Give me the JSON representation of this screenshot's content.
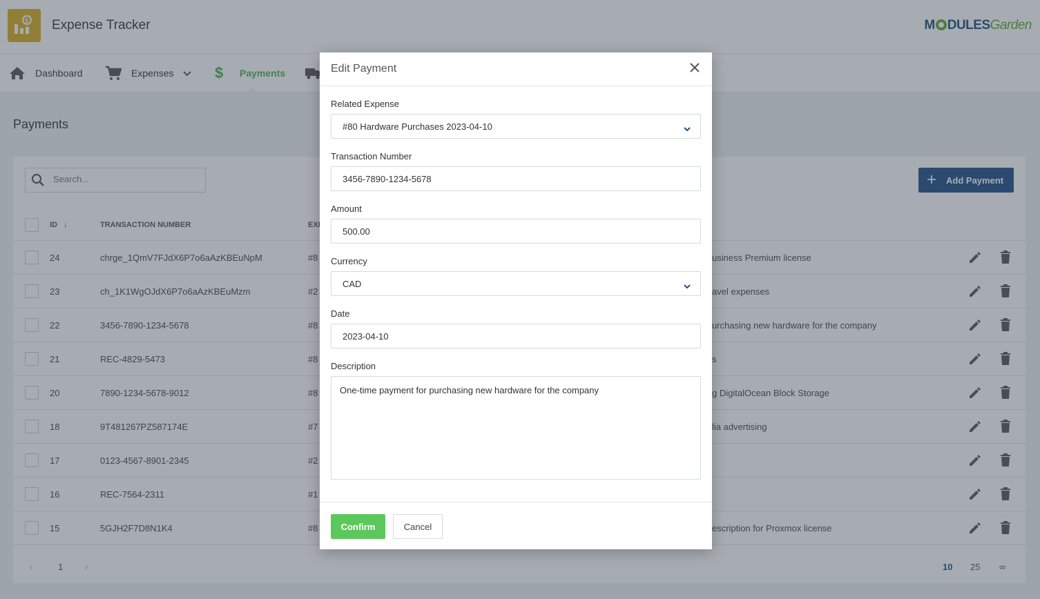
{
  "app": {
    "title": "Expense Tracker",
    "brand_a": "M",
    "brand_b": "DULES",
    "brand_c": "Garden"
  },
  "nav": {
    "dashboard": "Dashboard",
    "expenses": "Expenses",
    "payments": "Payments"
  },
  "page": {
    "title": "Payments"
  },
  "search": {
    "placeholder": "Search..."
  },
  "add_button": "Add Payment",
  "table": {
    "headers": {
      "id": "ID",
      "transaction": "TRANSACTION NUMBER",
      "expense": "EXP"
    },
    "rows": [
      {
        "id": "24",
        "tx": "chrge_1QmV7FJdX6P7o6aAzKBEuNpM",
        "exp": "#8",
        "desc": "usiness Premium license"
      },
      {
        "id": "23",
        "tx": "ch_1K1WgOJdX6P7o6aAzKBEuMzm",
        "exp": "#2",
        "desc": "avel expenses"
      },
      {
        "id": "22",
        "tx": "3456-7890-1234-5678",
        "exp": "#8",
        "desc": "urchasing new hardware for the company"
      },
      {
        "id": "21",
        "tx": "REC-4829-5473",
        "exp": "#8",
        "desc": "s"
      },
      {
        "id": "20",
        "tx": "7890-1234-5678-9012",
        "exp": "#8",
        "desc": "g DigitalOcean Block Storage"
      },
      {
        "id": "18",
        "tx": "9T481267PZ587174E",
        "exp": "#7",
        "desc": "lia advertising"
      },
      {
        "id": "17",
        "tx": "0123-4567-8901-2345",
        "exp": "#2",
        "desc": ""
      },
      {
        "id": "16",
        "tx": "REC-7564-2311",
        "exp": "#1",
        "desc": ""
      },
      {
        "id": "15",
        "tx": "5GJH2F7D8N1K4",
        "exp": "#8",
        "desc": "escription for Proxmox license"
      }
    ]
  },
  "pager": {
    "page": "1",
    "size_10": "10",
    "size_25": "25",
    "size_all": "∞"
  },
  "modal": {
    "title": "Edit Payment",
    "related_expense_label": "Related Expense",
    "related_expense_value": "#80 Hardware Purchases 2023-04-10",
    "transaction_label": "Transaction Number",
    "transaction_value": "3456-7890-1234-5678",
    "amount_label": "Amount",
    "amount_value": "500.00",
    "currency_label": "Currency",
    "currency_value": "CAD",
    "date_label": "Date",
    "date_value": "2023-04-10",
    "description_label": "Description",
    "description_value": "One-time payment for purchasing new hardware for the company",
    "confirm": "Confirm",
    "cancel": "Cancel"
  },
  "colors": {
    "accent": "#4cae4c",
    "primary": "#1f4e86",
    "confirm": "#5cc85c",
    "logo": "#d9ae1e"
  }
}
